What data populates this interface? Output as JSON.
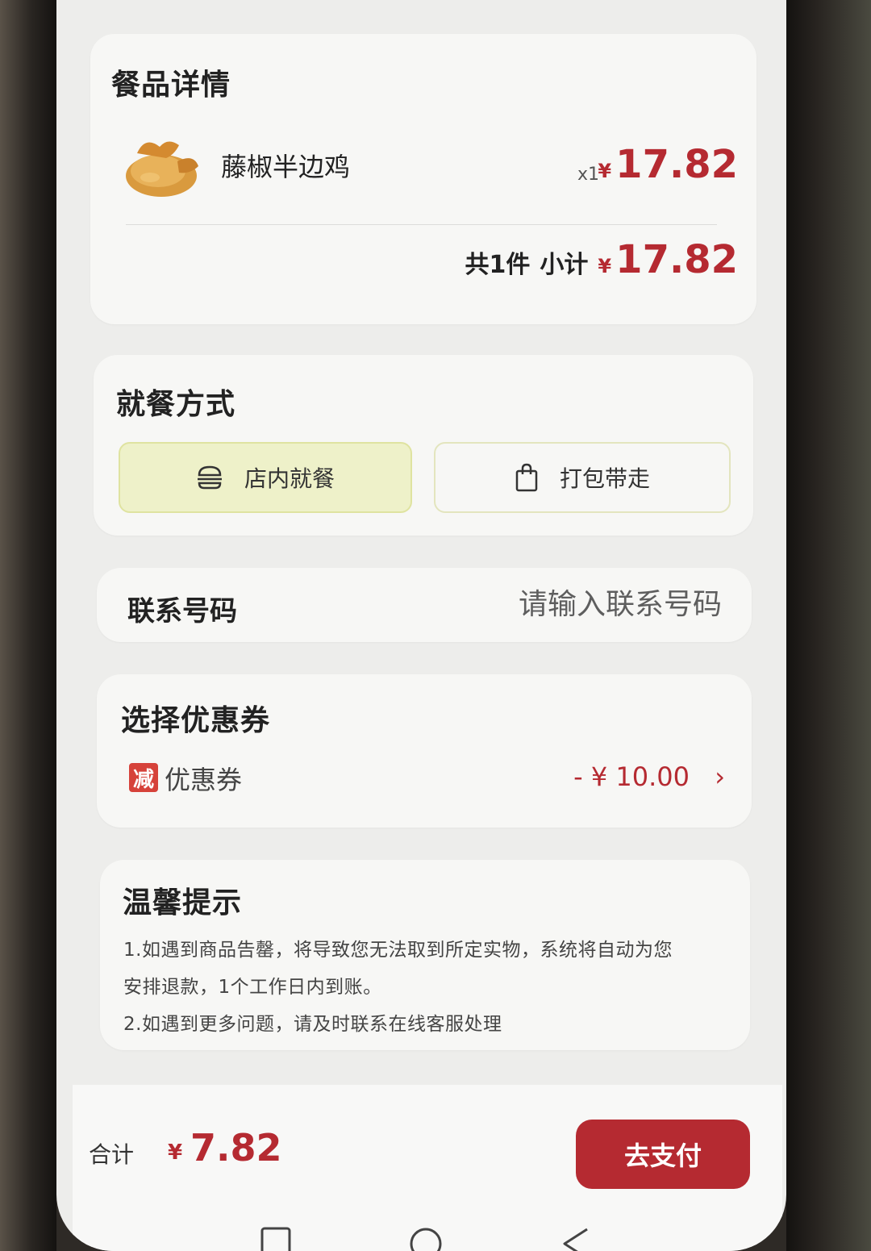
{
  "items_section": {
    "title": "餐品详情",
    "item": {
      "name": "藤椒半边鸡",
      "qty": "x1",
      "currency": "¥",
      "price": "17.82"
    },
    "summary": {
      "count_text": "共1件",
      "subtotal_label": "小计",
      "currency": "¥",
      "subtotal": "17.82"
    }
  },
  "dining_section": {
    "title": "就餐方式",
    "options": [
      {
        "label": "店内就餐",
        "icon": "burger-icon",
        "selected": true
      },
      {
        "label": "打包带走",
        "icon": "bag-icon",
        "selected": false
      }
    ]
  },
  "contact": {
    "label": "联系号码",
    "placeholder": "请输入联系号码"
  },
  "coupon_section": {
    "title": "选择优惠券",
    "badge": "减",
    "label": "优惠券",
    "amount": "- ¥ 10.00",
    "chevron": "›"
  },
  "tips_section": {
    "title": "温馨提示",
    "lines": [
      "1.如遇到商品告罄，将导致您无法取到所定实物，系统将自动为您",
      "安排退款，1个工作日内到账。",
      "2.如遇到更多问题，请及时联系在线客服处理"
    ]
  },
  "footer": {
    "total_label": "合计",
    "currency": "¥",
    "total": "7.82",
    "pay_label": "去支付"
  },
  "colors": {
    "accent": "#b52a31",
    "selected_option_bg": "#eef1c9",
    "badge": "#d6423a"
  }
}
